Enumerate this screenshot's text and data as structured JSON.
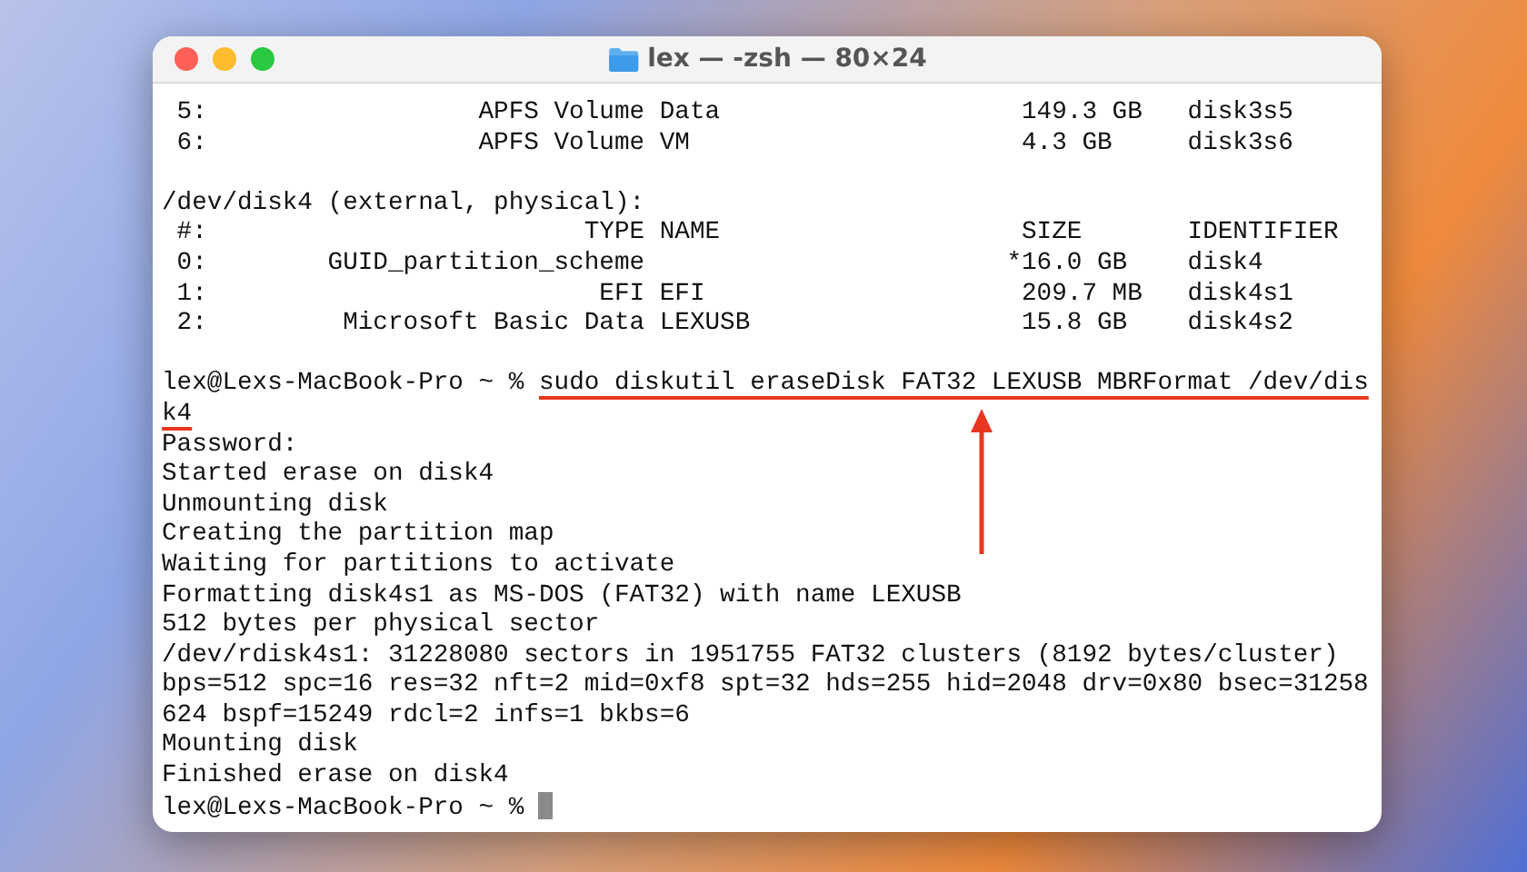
{
  "window": {
    "title": "lex — -zsh — 80×24"
  },
  "terminal": {
    "lines": [
      {
        "kind": "output",
        "text": " 5:                  APFS Volume Data                    149.3 GB   disk3s5"
      },
      {
        "kind": "output",
        "text": " 6:                  APFS Volume VM                      4.3 GB     disk3s6"
      },
      {
        "kind": "blank"
      },
      {
        "kind": "output",
        "text": "/dev/disk4 (external, physical):"
      },
      {
        "kind": "output",
        "text": " #:                         TYPE NAME                    SIZE       IDENTIFIER"
      },
      {
        "kind": "output",
        "text": " 0:        GUID_partition_scheme                        *16.0 GB    disk4"
      },
      {
        "kind": "output",
        "text": " 1:                          EFI EFI                     209.7 MB   disk4s1"
      },
      {
        "kind": "output",
        "text": " 2:         Microsoft Basic Data LEXUSB                  15.8 GB    disk4s2"
      },
      {
        "kind": "blank"
      },
      {
        "kind": "command",
        "prompt": "lex@Lexs-MacBook-Pro ~ % ",
        "text": "sudo diskutil eraseDisk FAT32 LEXUSB MBRFormat /dev/dis",
        "highlighted": true
      },
      {
        "kind": "command",
        "text": "k4",
        "highlighted": true,
        "arrow": true
      },
      {
        "kind": "output",
        "text": "Password:"
      },
      {
        "kind": "output",
        "text": "Started erase on disk4"
      },
      {
        "kind": "output",
        "text": "Unmounting disk"
      },
      {
        "kind": "output",
        "text": "Creating the partition map"
      },
      {
        "kind": "output",
        "text": "Waiting for partitions to activate"
      },
      {
        "kind": "output",
        "text": "Formatting disk4s1 as MS-DOS (FAT32) with name LEXUSB"
      },
      {
        "kind": "output",
        "text": "512 bytes per physical sector"
      },
      {
        "kind": "output",
        "text": "/dev/rdisk4s1: 31228080 sectors in 1951755 FAT32 clusters (8192 bytes/cluster)"
      },
      {
        "kind": "output",
        "text": "bps=512 spc=16 res=32 nft=2 mid=0xf8 spt=32 hds=255 hid=2048 drv=0x80 bsec=31258"
      },
      {
        "kind": "output",
        "text": "624 bspf=15249 rdcl=2 infs=1 bkbs=6"
      },
      {
        "kind": "output",
        "text": "Mounting disk"
      },
      {
        "kind": "output",
        "text": "Finished erase on disk4"
      },
      {
        "kind": "command",
        "prompt": "lex@Lexs-MacBook-Pro ~ % ",
        "cursor": true
      }
    ]
  }
}
